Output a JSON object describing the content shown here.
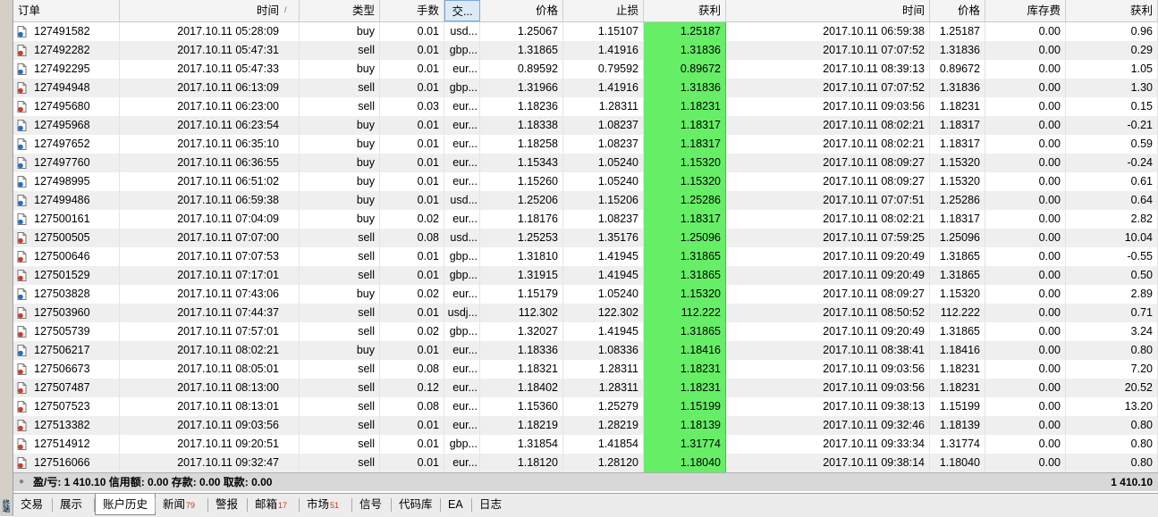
{
  "side_label": "终端",
  "columns": {
    "order": "订单",
    "open_time": "时间",
    "sort_mark": "/",
    "type": "类型",
    "lots": "手数",
    "symbol": "交...",
    "open_price": "价格",
    "sl": "止损",
    "tp": "获利",
    "close_time": "时间",
    "close_price": "价格",
    "swap": "库存费",
    "profit": "获利"
  },
  "rows": [
    {
      "order": "127491582",
      "open_time": "2017.10.11 05:28:09",
      "type": "buy",
      "lots": "0.01",
      "symbol": "usd...",
      "open_price": "1.25067",
      "sl": "1.15107",
      "tp": "1.25187",
      "close_time": "2017.10.11 06:59:38",
      "close_price": "1.25187",
      "swap": "0.00",
      "profit": "0.96"
    },
    {
      "order": "127492282",
      "open_time": "2017.10.11 05:47:31",
      "type": "sell",
      "lots": "0.01",
      "symbol": "gbp...",
      "open_price": "1.31865",
      "sl": "1.41916",
      "tp": "1.31836",
      "close_time": "2017.10.11 07:07:52",
      "close_price": "1.31836",
      "swap": "0.00",
      "profit": "0.29"
    },
    {
      "order": "127492295",
      "open_time": "2017.10.11 05:47:33",
      "type": "buy",
      "lots": "0.01",
      "symbol": "eur...",
      "open_price": "0.89592",
      "sl": "0.79592",
      "tp": "0.89672",
      "close_time": "2017.10.11 08:39:13",
      "close_price": "0.89672",
      "swap": "0.00",
      "profit": "1.05"
    },
    {
      "order": "127494948",
      "open_time": "2017.10.11 06:13:09",
      "type": "sell",
      "lots": "0.01",
      "symbol": "gbp...",
      "open_price": "1.31966",
      "sl": "1.41916",
      "tp": "1.31836",
      "close_time": "2017.10.11 07:07:52",
      "close_price": "1.31836",
      "swap": "0.00",
      "profit": "1.30"
    },
    {
      "order": "127495680",
      "open_time": "2017.10.11 06:23:00",
      "type": "sell",
      "lots": "0.03",
      "symbol": "eur...",
      "open_price": "1.18236",
      "sl": "1.28311",
      "tp": "1.18231",
      "close_time": "2017.10.11 09:03:56",
      "close_price": "1.18231",
      "swap": "0.00",
      "profit": "0.15"
    },
    {
      "order": "127495968",
      "open_time": "2017.10.11 06:23:54",
      "type": "buy",
      "lots": "0.01",
      "symbol": "eur...",
      "open_price": "1.18338",
      "sl": "1.08237",
      "tp": "1.18317",
      "close_time": "2017.10.11 08:02:21",
      "close_price": "1.18317",
      "swap": "0.00",
      "profit": "-0.21"
    },
    {
      "order": "127497652",
      "open_time": "2017.10.11 06:35:10",
      "type": "buy",
      "lots": "0.01",
      "symbol": "eur...",
      "open_price": "1.18258",
      "sl": "1.08237",
      "tp": "1.18317",
      "close_time": "2017.10.11 08:02:21",
      "close_price": "1.18317",
      "swap": "0.00",
      "profit": "0.59"
    },
    {
      "order": "127497760",
      "open_time": "2017.10.11 06:36:55",
      "type": "buy",
      "lots": "0.01",
      "symbol": "eur...",
      "open_price": "1.15343",
      "sl": "1.05240",
      "tp": "1.15320",
      "close_time": "2017.10.11 08:09:27",
      "close_price": "1.15320",
      "swap": "0.00",
      "profit": "-0.24"
    },
    {
      "order": "127498995",
      "open_time": "2017.10.11 06:51:02",
      "type": "buy",
      "lots": "0.01",
      "symbol": "eur...",
      "open_price": "1.15260",
      "sl": "1.05240",
      "tp": "1.15320",
      "close_time": "2017.10.11 08:09:27",
      "close_price": "1.15320",
      "swap": "0.00",
      "profit": "0.61"
    },
    {
      "order": "127499486",
      "open_time": "2017.10.11 06:59:38",
      "type": "buy",
      "lots": "0.01",
      "symbol": "usd...",
      "open_price": "1.25206",
      "sl": "1.15206",
      "tp": "1.25286",
      "close_time": "2017.10.11 07:07:51",
      "close_price": "1.25286",
      "swap": "0.00",
      "profit": "0.64"
    },
    {
      "order": "127500161",
      "open_time": "2017.10.11 07:04:09",
      "type": "buy",
      "lots": "0.02",
      "symbol": "eur...",
      "open_price": "1.18176",
      "sl": "1.08237",
      "tp": "1.18317",
      "close_time": "2017.10.11 08:02:21",
      "close_price": "1.18317",
      "swap": "0.00",
      "profit": "2.82"
    },
    {
      "order": "127500505",
      "open_time": "2017.10.11 07:07:00",
      "type": "sell",
      "lots": "0.08",
      "symbol": "usd...",
      "open_price": "1.25253",
      "sl": "1.35176",
      "tp": "1.25096",
      "close_time": "2017.10.11 07:59:25",
      "close_price": "1.25096",
      "swap": "0.00",
      "profit": "10.04"
    },
    {
      "order": "127500646",
      "open_time": "2017.10.11 07:07:53",
      "type": "sell",
      "lots": "0.01",
      "symbol": "gbp...",
      "open_price": "1.31810",
      "sl": "1.41945",
      "tp": "1.31865",
      "close_time": "2017.10.11 09:20:49",
      "close_price": "1.31865",
      "swap": "0.00",
      "profit": "-0.55"
    },
    {
      "order": "127501529",
      "open_time": "2017.10.11 07:17:01",
      "type": "sell",
      "lots": "0.01",
      "symbol": "gbp...",
      "open_price": "1.31915",
      "sl": "1.41945",
      "tp": "1.31865",
      "close_time": "2017.10.11 09:20:49",
      "close_price": "1.31865",
      "swap": "0.00",
      "profit": "0.50"
    },
    {
      "order": "127503828",
      "open_time": "2017.10.11 07:43:06",
      "type": "buy",
      "lots": "0.02",
      "symbol": "eur...",
      "open_price": "1.15179",
      "sl": "1.05240",
      "tp": "1.15320",
      "close_time": "2017.10.11 08:09:27",
      "close_price": "1.15320",
      "swap": "0.00",
      "profit": "2.89"
    },
    {
      "order": "127503960",
      "open_time": "2017.10.11 07:44:37",
      "type": "sell",
      "lots": "0.01",
      "symbol": "usdj...",
      "open_price": "112.302",
      "sl": "122.302",
      "tp": "112.222",
      "close_time": "2017.10.11 08:50:52",
      "close_price": "112.222",
      "swap": "0.00",
      "profit": "0.71"
    },
    {
      "order": "127505739",
      "open_time": "2017.10.11 07:57:01",
      "type": "sell",
      "lots": "0.02",
      "symbol": "gbp...",
      "open_price": "1.32027",
      "sl": "1.41945",
      "tp": "1.31865",
      "close_time": "2017.10.11 09:20:49",
      "close_price": "1.31865",
      "swap": "0.00",
      "profit": "3.24"
    },
    {
      "order": "127506217",
      "open_time": "2017.10.11 08:02:21",
      "type": "buy",
      "lots": "0.01",
      "symbol": "eur...",
      "open_price": "1.18336",
      "sl": "1.08336",
      "tp": "1.18416",
      "close_time": "2017.10.11 08:38:41",
      "close_price": "1.18416",
      "swap": "0.00",
      "profit": "0.80"
    },
    {
      "order": "127506673",
      "open_time": "2017.10.11 08:05:01",
      "type": "sell",
      "lots": "0.08",
      "symbol": "eur...",
      "open_price": "1.18321",
      "sl": "1.28311",
      "tp": "1.18231",
      "close_time": "2017.10.11 09:03:56",
      "close_price": "1.18231",
      "swap": "0.00",
      "profit": "7.20"
    },
    {
      "order": "127507487",
      "open_time": "2017.10.11 08:13:00",
      "type": "sell",
      "lots": "0.12",
      "symbol": "eur...",
      "open_price": "1.18402",
      "sl": "1.28311",
      "tp": "1.18231",
      "close_time": "2017.10.11 09:03:56",
      "close_price": "1.18231",
      "swap": "0.00",
      "profit": "20.52"
    },
    {
      "order": "127507523",
      "open_time": "2017.10.11 08:13:01",
      "type": "sell",
      "lots": "0.08",
      "symbol": "eur...",
      "open_price": "1.15360",
      "sl": "1.25279",
      "tp": "1.15199",
      "close_time": "2017.10.11 09:38:13",
      "close_price": "1.15199",
      "swap": "0.00",
      "profit": "13.20"
    },
    {
      "order": "127513382",
      "open_time": "2017.10.11 09:03:56",
      "type": "sell",
      "lots": "0.01",
      "symbol": "eur...",
      "open_price": "1.18219",
      "sl": "1.28219",
      "tp": "1.18139",
      "close_time": "2017.10.11 09:32:46",
      "close_price": "1.18139",
      "swap": "0.00",
      "profit": "0.80"
    },
    {
      "order": "127514912",
      "open_time": "2017.10.11 09:20:51",
      "type": "sell",
      "lots": "0.01",
      "symbol": "gbp...",
      "open_price": "1.31854",
      "sl": "1.41854",
      "tp": "1.31774",
      "close_time": "2017.10.11 09:33:34",
      "close_price": "1.31774",
      "swap": "0.00",
      "profit": "0.80"
    },
    {
      "order": "127516066",
      "open_time": "2017.10.11 09:32:47",
      "type": "sell",
      "lots": "0.01",
      "symbol": "eur...",
      "open_price": "1.18120",
      "sl": "1.28120",
      "tp": "1.18040",
      "close_time": "2017.10.11 09:38:14",
      "close_price": "1.18040",
      "swap": "0.00",
      "profit": "0.80"
    }
  ],
  "summary": {
    "text": "盈/亏: 1 410.10  信用额: 0.00  存款: 0.00  取款: 0.00",
    "total": "1 410.10"
  },
  "tabs": [
    {
      "label": "交易",
      "badge": ""
    },
    {
      "label": "展示",
      "badge": ""
    },
    {
      "label": "账户历史",
      "badge": "",
      "active": true
    },
    {
      "label": "新闻",
      "badge": "79"
    },
    {
      "label": "警报",
      "badge": ""
    },
    {
      "label": "邮箱",
      "badge": "17"
    },
    {
      "label": "市场",
      "badge": "51"
    },
    {
      "label": "信号",
      "badge": ""
    },
    {
      "label": "代码库",
      "badge": ""
    },
    {
      "label": "EA",
      "badge": ""
    },
    {
      "label": "日志",
      "badge": ""
    }
  ],
  "colors": {
    "tp_highlight": "#66ee66",
    "buy_icon": "#1f6fd0",
    "sell_icon": "#d23a2a",
    "badge": "#d03020"
  }
}
